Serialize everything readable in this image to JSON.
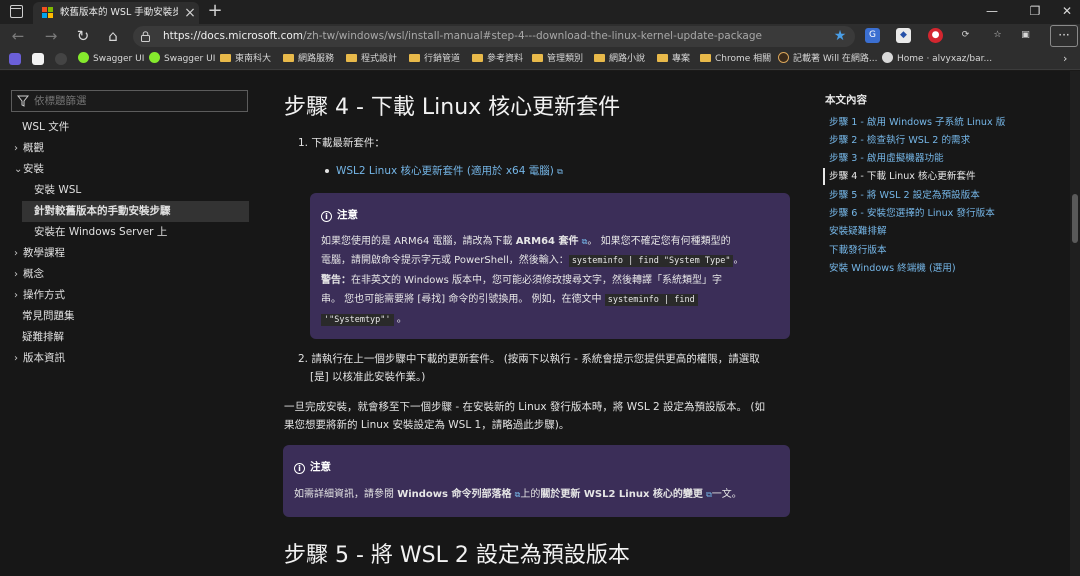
{
  "browser": {
    "tab_title": "較舊版本的 WSL 手動安裝步驟 |",
    "tab_close": "×",
    "new_tab": "+",
    "window_controls": [
      "—",
      "❐",
      "✕"
    ],
    "url_host": "https://docs.microsoft.com",
    "url_path": "/zh-tw/windows/wsl/install-manual#step-4---download-the-linux-kernel-update-package",
    "extensions": [
      "search-ext-icon",
      "shield-ext-icon",
      "record-ext-icon",
      "refresh-ext-icon",
      "favorites-icon",
      "collections-icon",
      "profile-icon"
    ],
    "more_menu": "···"
  },
  "bookmarks": [
    {
      "label": "Swagger UI",
      "icon": "swagger-icon",
      "color": "#85ea2d"
    },
    {
      "label": "Swagger UI",
      "icon": "swagger-icon",
      "color": "#85ea2d"
    },
    {
      "label": "東南科大",
      "icon": "folder-icon",
      "color": "#e8b94a"
    },
    {
      "label": "網路服務",
      "icon": "folder-icon",
      "color": "#e8b94a"
    },
    {
      "label": "程式設計",
      "icon": "folder-icon",
      "color": "#e8b94a"
    },
    {
      "label": "行銷管道",
      "icon": "folder-icon",
      "color": "#e8b94a"
    },
    {
      "label": "參考資料",
      "icon": "folder-icon",
      "color": "#e8b94a"
    },
    {
      "label": "管理類別",
      "icon": "folder-icon",
      "color": "#e8b94a"
    },
    {
      "label": "網路小說",
      "icon": "folder-icon",
      "color": "#e8b94a"
    },
    {
      "label": "專案",
      "icon": "folder-icon",
      "color": "#e8b94a"
    },
    {
      "label": "Chrome 相關",
      "icon": "folder-icon",
      "color": "#e8b94a"
    },
    {
      "label": "記載著 Will 在網路...",
      "icon": "site-icon",
      "color": "#d9d9d9"
    },
    {
      "label": "Home · alvyxaz/bar...",
      "icon": "github-icon",
      "color": "#d9d9d9"
    }
  ],
  "sidebar": {
    "filter_placeholder": "依標題篩選",
    "items": [
      {
        "label": "WSL 文件",
        "chevron": ""
      },
      {
        "label": "概觀",
        "chevron": "›"
      },
      {
        "label": "安裝",
        "chevron": "⌄"
      },
      {
        "label": "安裝 WSL",
        "chevron": ""
      },
      {
        "label": "針對較舊版本的手動安裝步驟",
        "chevron": ""
      },
      {
        "label": "安裝在 Windows Server 上",
        "chevron": ""
      },
      {
        "label": "教學課程",
        "chevron": "›"
      },
      {
        "label": "概念",
        "chevron": "›"
      },
      {
        "label": "操作方式",
        "chevron": "›"
      },
      {
        "label": "常見問題集",
        "chevron": ""
      },
      {
        "label": "疑難排解",
        "chevron": ""
      },
      {
        "label": "版本資訊",
        "chevron": "›"
      }
    ]
  },
  "main": {
    "heading": "步驟 4 - 下載 Linux 核心更新套件",
    "step1": "1. 下載最新套件：",
    "step1_link": "WSL2 Linux 核心更新套件 (適用於 x64 電腦)",
    "note1": {
      "title": "注意",
      "t1": "如果您使用的是 ARM64 電腦，請改為下載 ",
      "t1_link": "ARM64 套件",
      "t2": "。 如果您不確定您有何種類型的",
      "t3": "電腦，請開啟命令提示字元或 PowerShell，然後輸入：",
      "code1": "systeminfo | find \"System Type\"",
      "t3_end": "。",
      "t4_strong": "警告：",
      "t4": "在非英文的 Windows 版本中，您可能必須修改搜尋文字，然後轉譯「系統類型」字",
      "t5": "串。 您也可能需要將 [尋找] 命令的引號換用。 例如，在德文中 ",
      "code2": "systeminfo | find",
      "code3": "'\"Systemtyp\"'",
      "t6_end": " 。"
    },
    "step2_a": "2. 請執行在上一個步驟中下載的更新套件。 (按兩下以執行 - 系統會提示您提供更高的權限，請選取",
    "step2_b": "[是] 以核准此安裝作業。)",
    "para_a": "一旦完成安裝，就會移至下一個步驟 - 在安裝新的 Linux 發行版本時，將 WSL 2 設定為預設版本。 (如",
    "para_b": "果您想要將新的 Linux 安裝設定為 WSL 1，請略過此步驟)。",
    "note2": {
      "title": "注意",
      "t1": "如需詳細資訊，請參閱 ",
      "link1": "Windows 命令列部落格",
      "t2": "上的",
      "link2": "關於更新 WSL2 Linux 核心的變更",
      "t3": "一文。"
    },
    "heading2": "步驟 5 - 將 WSL 2 設定為預設版本"
  },
  "toc": {
    "title": "本文內容",
    "items": [
      "步驟 1 - 啟用 Windows 子系統 Linux 版",
      "步驟 2 - 檢查執行 WSL 2 的需求",
      "步驟 3 - 啟用虛擬機器功能",
      "步驟 4 - 下載 Linux 核心更新套件",
      "步驟 5 - 將 WSL 2 設定為預設版本",
      "步驟 6 - 安裝您選擇的 Linux 發行版本",
      "安裝疑難排解",
      "下載發行版本",
      "安裝 Windows 終端機 (選用)"
    ],
    "active_index": 3
  },
  "colors": {
    "accent_link": "#75b6e7",
    "note_bg": "#3b2e58",
    "page_bg": "#171717"
  }
}
